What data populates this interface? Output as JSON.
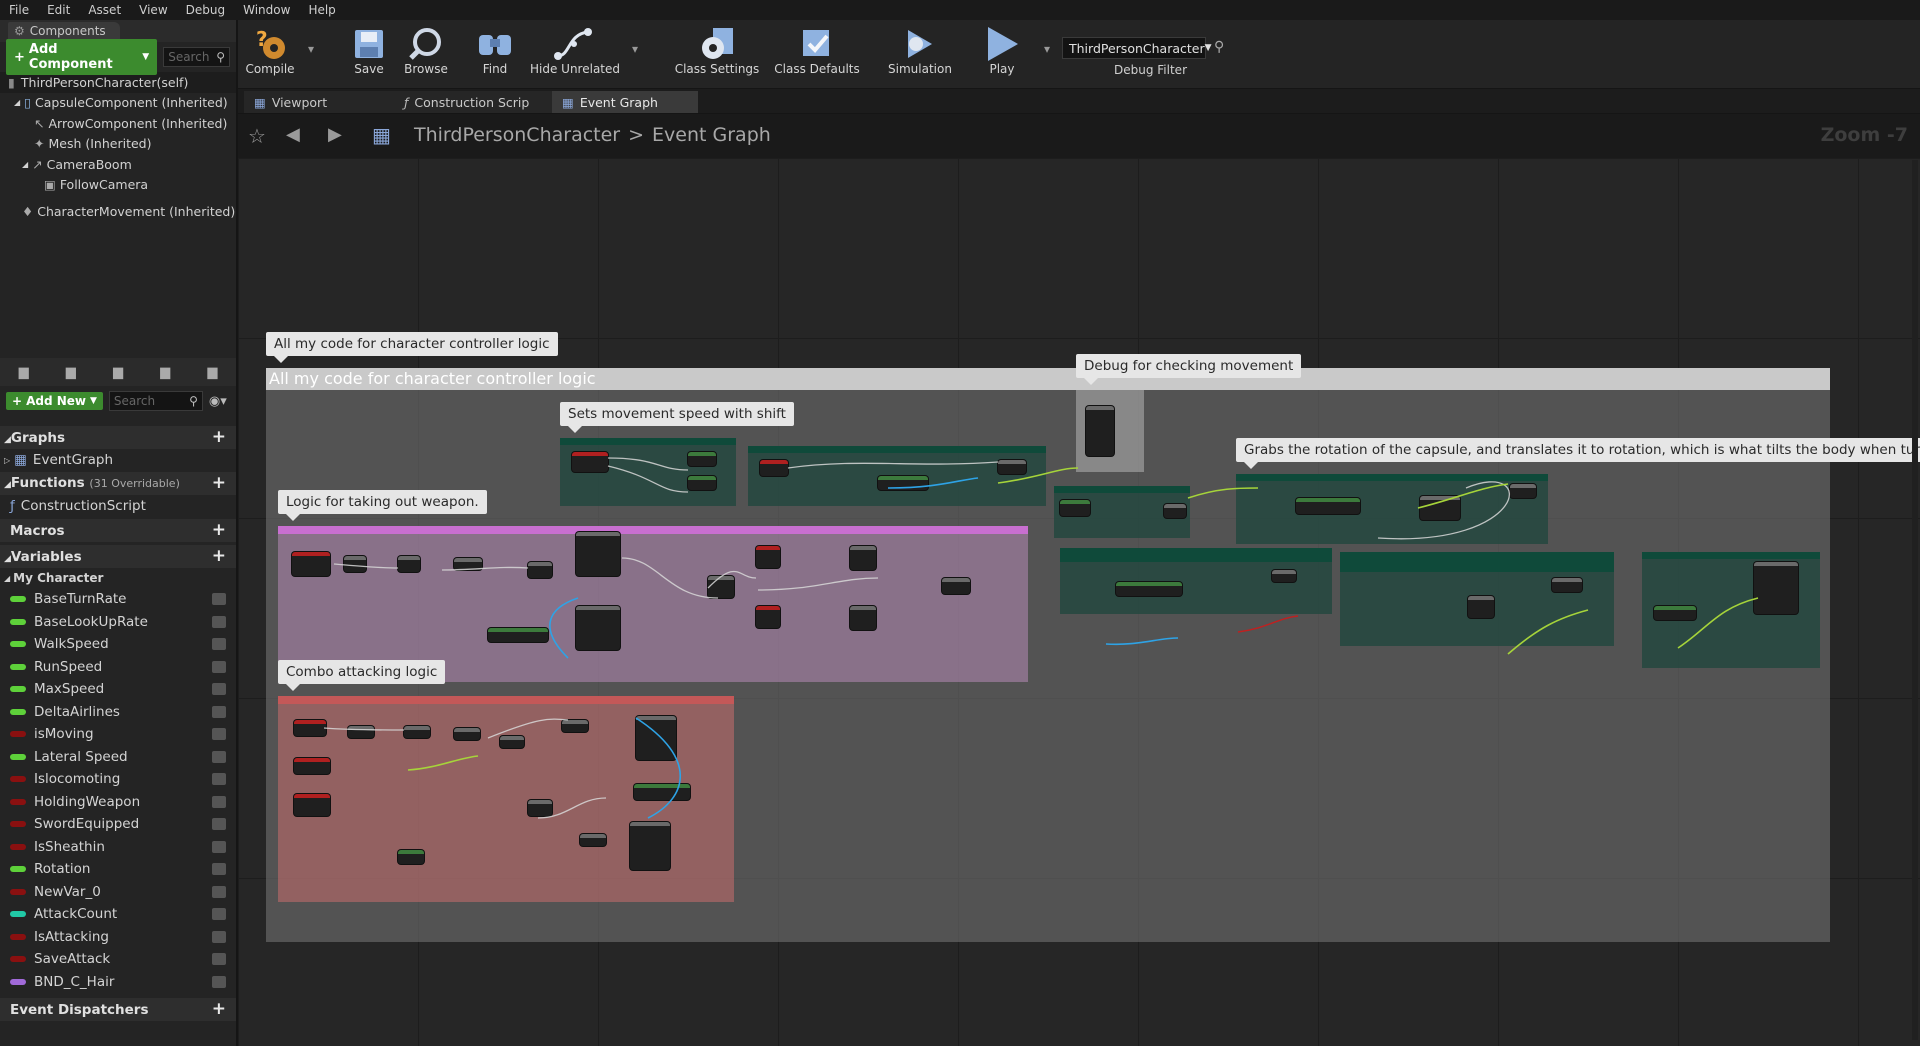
{
  "menu": [
    "File",
    "Edit",
    "Asset",
    "View",
    "Debug",
    "Window",
    "Help"
  ],
  "components": {
    "title": "Components",
    "add_label": "Add Component",
    "search_placeholder": "Search",
    "items": [
      "ThirdPersonCharacter(self)",
      "CapsuleComponent (Inherited)",
      "ArrowComponent (Inherited)",
      "Mesh (Inherited)",
      "CameraBoom",
      "FollowCamera",
      "CharacterMovement (Inherited)"
    ]
  },
  "mybp": {
    "add_label": "Add New",
    "search_placeholder": "Search",
    "graphs_label": "Graphs",
    "graph_item": "EventGraph",
    "functions_label": "Functions",
    "functions_note": "(31 Overridable)",
    "function_item": "ConstructionScript",
    "macros_label": "Macros",
    "variables_label": "Variables",
    "my_character_label": "My Character",
    "variables": [
      {
        "name": "BaseTurnRate",
        "color": "#5ed13a"
      },
      {
        "name": "BaseLookUpRate",
        "color": "#5ed13a"
      },
      {
        "name": "WalkSpeed",
        "color": "#5ed13a"
      },
      {
        "name": "RunSpeed",
        "color": "#5ed13a"
      },
      {
        "name": "MaxSpeed",
        "color": "#5ed13a"
      },
      {
        "name": "DeltaAirlines",
        "color": "#5ed13a"
      },
      {
        "name": "isMoving",
        "color": "#8a1010"
      },
      {
        "name": "Lateral Speed",
        "color": "#5ed13a"
      },
      {
        "name": "Islocomoting",
        "color": "#8a1010"
      },
      {
        "name": "HoldingWeapon",
        "color": "#8a1010"
      },
      {
        "name": "SwordEquipped",
        "color": "#8a1010"
      },
      {
        "name": "IsSheathin",
        "color": "#8a1010"
      },
      {
        "name": "Rotation",
        "color": "#5ed13a"
      },
      {
        "name": "NewVar_0",
        "color": "#8a1010"
      },
      {
        "name": "AttackCount",
        "color": "#21c9a6"
      },
      {
        "name": "IsAttacking",
        "color": "#8a1010"
      },
      {
        "name": "SaveAttack",
        "color": "#8a1010"
      },
      {
        "name": "BND_C_Hair",
        "color": "#a16ad9"
      }
    ],
    "dispatchers_label": "Event Dispatchers"
  },
  "toolbar": {
    "compile": "Compile",
    "save": "Save",
    "browse": "Browse",
    "find": "Find",
    "hide_unrelated": "Hide Unrelated",
    "class_settings": "Class Settings",
    "class_defaults": "Class Defaults",
    "simulation": "Simulation",
    "play": "Play",
    "debug_value": "ThirdPersonCharacter",
    "debug_filter": "Debug Filter"
  },
  "tabs": [
    "Viewport",
    "Construction Scrip",
    "Event Graph"
  ],
  "breadcrumb": {
    "root": "ThirdPersonCharacter",
    "sep": ">",
    "current": "Event Graph"
  },
  "zoom": "Zoom -7",
  "comments": {
    "main": "All my code for character controller logic",
    "debug_movement": "Debug for checking movement",
    "movement_speed": "Sets movement speed with shift",
    "rotation": "Grabs the rotation of the capsule, and translates it to rotation, which is what tilts the body when turning.",
    "weapon": "Logic for taking out weapon.",
    "combo": "Combo attacking logic"
  },
  "colors": {
    "accent_green": "#3c8b2e",
    "weapon_comment": "#c86fd0",
    "combo_comment": "#c45858",
    "teal_comment": "#1c5a4a"
  }
}
